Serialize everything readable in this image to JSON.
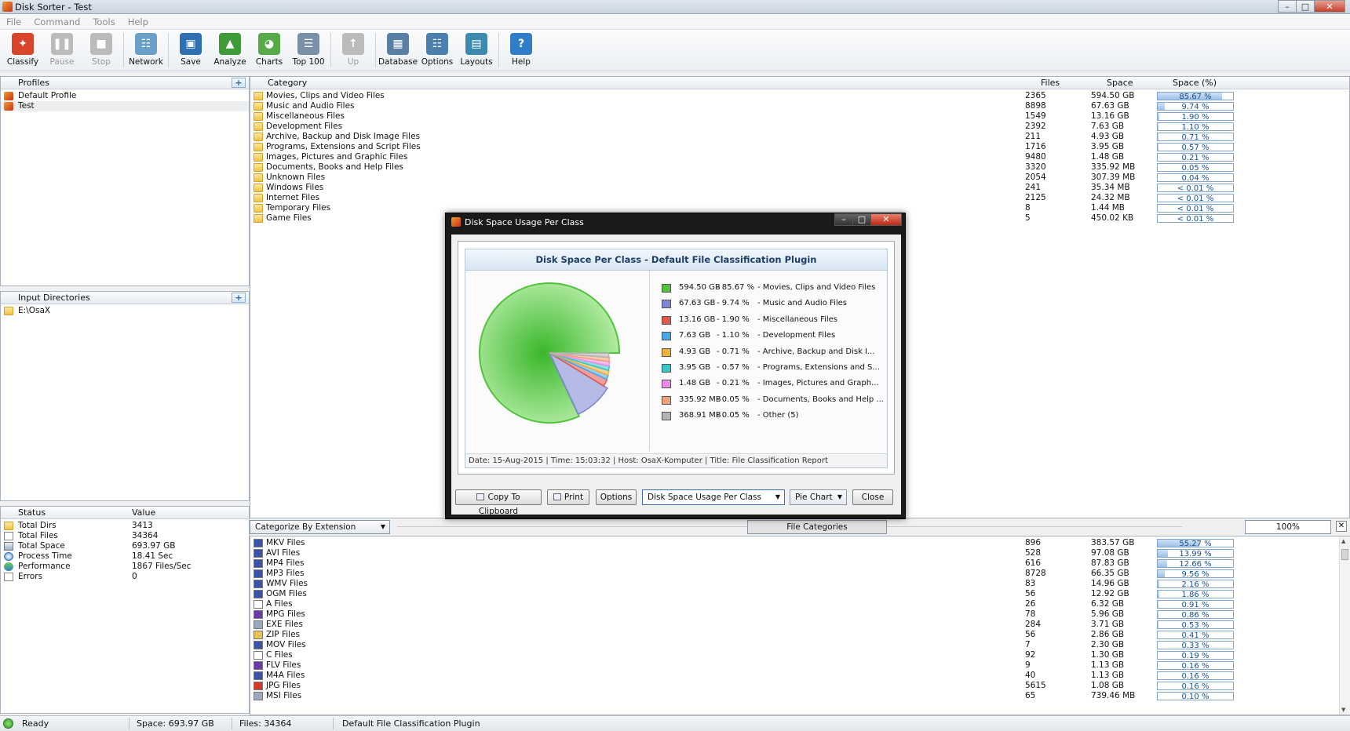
{
  "window": {
    "title": "Disk Sorter - Test",
    "min": "–",
    "max": "□",
    "close": "✕"
  },
  "menu": [
    "File",
    "Command",
    "Tools",
    "Help"
  ],
  "toolbar": [
    {
      "label": "Classify",
      "icon": "classify-icon",
      "color": "#d9452b",
      "glyph": "✦",
      "disabled": false
    },
    {
      "label": "Pause",
      "icon": "pause-icon",
      "color": "#999",
      "glyph": "❚❚",
      "disabled": true
    },
    {
      "label": "Stop",
      "icon": "stop-icon",
      "color": "#999",
      "glyph": "■",
      "disabled": true
    },
    {
      "sep": true
    },
    {
      "label": "Network",
      "icon": "network-icon",
      "color": "#6aa0c8",
      "glyph": "☷",
      "disabled": false
    },
    {
      "sep": true
    },
    {
      "label": "Save",
      "icon": "save-icon",
      "color": "#2f6fb3",
      "glyph": "▣",
      "disabled": false
    },
    {
      "label": "Analyze",
      "icon": "analyze-icon",
      "color": "#3f9a3a",
      "glyph": "▲",
      "disabled": false
    },
    {
      "label": "Charts",
      "icon": "charts-icon",
      "color": "#57a94a",
      "glyph": "◕",
      "disabled": false
    },
    {
      "label": "Top 100",
      "icon": "top100-icon",
      "color": "#7a8fa8",
      "glyph": "☰",
      "disabled": false
    },
    {
      "sep": true
    },
    {
      "label": "Up",
      "icon": "up-arrow-icon",
      "color": "#aaa",
      "glyph": "↑",
      "disabled": true
    },
    {
      "sep": true
    },
    {
      "label": "Database",
      "icon": "database-icon",
      "color": "#5a7fa6",
      "glyph": "▦",
      "disabled": false
    },
    {
      "label": "Options",
      "icon": "options-icon",
      "color": "#4a7fae",
      "glyph": "☷",
      "disabled": false
    },
    {
      "label": "Layouts",
      "icon": "layouts-icon",
      "color": "#3d8ab0",
      "glyph": "▤",
      "disabled": false
    },
    {
      "sep": true
    },
    {
      "label": "Help",
      "icon": "help-icon",
      "color": "#2f7ec7",
      "glyph": "?",
      "disabled": false
    }
  ],
  "profiles": {
    "header": "Profiles",
    "items": [
      {
        "label": "Default Profile",
        "selected": false
      },
      {
        "label": "Test",
        "selected": true
      }
    ]
  },
  "input_dirs": {
    "header": "Input Directories",
    "items": [
      "E:\\OsaX"
    ]
  },
  "status_panel": {
    "col1": "Status",
    "col2": "Value",
    "rows": [
      {
        "label": "Total Dirs",
        "value": "3413",
        "icon": "folder-icon"
      },
      {
        "label": "Total Files",
        "value": "34364",
        "icon": "file-icon"
      },
      {
        "label": "Total Space",
        "value": "693.97 GB",
        "icon": "disk-icon"
      },
      {
        "label": "Process Time",
        "value": "18.41 Sec",
        "icon": "clock-icon"
      },
      {
        "label": "Performance",
        "value": "1867 Files/Sec",
        "icon": "performance-icon"
      },
      {
        "label": "Errors",
        "value": "0",
        "icon": "errors-icon"
      }
    ]
  },
  "categories_table": {
    "headers": {
      "category": "Category",
      "files": "Files",
      "space": "Space",
      "pct": "Space (%)"
    },
    "rows": [
      {
        "name": "Movies, Clips and Video Files",
        "files": "2365",
        "space": "594.50 GB",
        "pct": "85.67 %",
        "fill": 0.8567
      },
      {
        "name": "Music and Audio Files",
        "files": "8898",
        "space": "67.63 GB",
        "pct": "9.74 %",
        "fill": 0.0974
      },
      {
        "name": "Miscellaneous Files",
        "files": "1549",
        "space": "13.16 GB",
        "pct": "1.90 %",
        "fill": 0.019
      },
      {
        "name": "Development Files",
        "files": "2392",
        "space": "7.63 GB",
        "pct": "1.10 %",
        "fill": 0.011
      },
      {
        "name": "Archive, Backup and Disk Image Files",
        "files": "211",
        "space": "4.93 GB",
        "pct": "0.71 %",
        "fill": 0.0071
      },
      {
        "name": "Programs, Extensions and Script Files",
        "files": "1716",
        "space": "3.95 GB",
        "pct": "0.57 %",
        "fill": 0.0057
      },
      {
        "name": "Images, Pictures and Graphic Files",
        "files": "9480",
        "space": "1.48 GB",
        "pct": "0.21 %",
        "fill": 0.0021
      },
      {
        "name": "Documents, Books and Help Files",
        "files": "3320",
        "space": "335.92 MB",
        "pct": "0.05 %",
        "fill": 0.0005
      },
      {
        "name": "Unknown Files",
        "files": "2054",
        "space": "307.39 MB",
        "pct": "0.04 %",
        "fill": 0.0004
      },
      {
        "name": "Windows Files",
        "files": "241",
        "space": "35.34 MB",
        "pct": "< 0.01 %",
        "fill": 0
      },
      {
        "name": "Internet Files",
        "files": "2125",
        "space": "24.32 MB",
        "pct": "< 0.01 %",
        "fill": 0
      },
      {
        "name": "Temporary Files",
        "files": "8",
        "space": "1.44 MB",
        "pct": "< 0.01 %",
        "fill": 0
      },
      {
        "name": "Game Files",
        "files": "5",
        "space": "450.02 KB",
        "pct": "< 0.01 %",
        "fill": 0
      }
    ]
  },
  "midbar": {
    "categorize": "Categorize By Extension",
    "tab": "File Categories",
    "zoom": "100%",
    "close": "✕"
  },
  "extensions_table": {
    "rows": [
      {
        "name": "MKV Files",
        "files": "896",
        "space": "383.57 GB",
        "pct": "55.27 %",
        "fill": 0.5527,
        "color": "#3a52a8"
      },
      {
        "name": "AVI Files",
        "files": "528",
        "space": "97.08 GB",
        "pct": "13.99 %",
        "fill": 0.1399,
        "color": "#3a52a8"
      },
      {
        "name": "MP4 Files",
        "files": "616",
        "space": "87.83 GB",
        "pct": "12.66 %",
        "fill": 0.1266,
        "color": "#3a52a8"
      },
      {
        "name": "MP3 Files",
        "files": "8728",
        "space": "66.35 GB",
        "pct": "9.56 %",
        "fill": 0.0956,
        "color": "#3a52a8"
      },
      {
        "name": "WMV Files",
        "files": "83",
        "space": "14.96 GB",
        "pct": "2.16 %",
        "fill": 0.0216,
        "color": "#3a52a8"
      },
      {
        "name": "OGM Files",
        "files": "56",
        "space": "12.92 GB",
        "pct": "1.86 %",
        "fill": 0.0186,
        "color": "#3a52a8"
      },
      {
        "name": "A Files",
        "files": "26",
        "space": "6.32 GB",
        "pct": "0.91 %",
        "fill": 0.0091,
        "color": "#ffffff"
      },
      {
        "name": "MPG Files",
        "files": "78",
        "space": "5.96 GB",
        "pct": "0.86 %",
        "fill": 0.0086,
        "color": "#6a3aa8"
      },
      {
        "name": "EXE Files",
        "files": "284",
        "space": "3.71 GB",
        "pct": "0.53 %",
        "fill": 0.0053,
        "color": "#9aa9bd"
      },
      {
        "name": "ZIP Files",
        "files": "56",
        "space": "2.86 GB",
        "pct": "0.41 %",
        "fill": 0.0041,
        "color": "#e7c451"
      },
      {
        "name": "MOV Files",
        "files": "7",
        "space": "2.30 GB",
        "pct": "0.33 %",
        "fill": 0.0033,
        "color": "#3a52a8"
      },
      {
        "name": "C Files",
        "files": "92",
        "space": "1.30 GB",
        "pct": "0.19 %",
        "fill": 0.0019,
        "color": "#ffffff"
      },
      {
        "name": "FLV Files",
        "files": "9",
        "space": "1.13 GB",
        "pct": "0.16 %",
        "fill": 0.0016,
        "color": "#6a3aa8"
      },
      {
        "name": "M4A Files",
        "files": "40",
        "space": "1.13 GB",
        "pct": "0.16 %",
        "fill": 0.0016,
        "color": "#3a52a8"
      },
      {
        "name": "JPG Files",
        "files": "5615",
        "space": "1.08 GB",
        "pct": "0.16 %",
        "fill": 0.0016,
        "color": "#d43a2a"
      },
      {
        "name": "MSI Files",
        "files": "65",
        "space": "739.46 MB",
        "pct": "0.10 %",
        "fill": 0.001,
        "color": "#9aa9bd"
      }
    ]
  },
  "statusbar": {
    "state": "Ready",
    "space": "Space: 693.97 GB",
    "files": "Files: 34364",
    "plugin": "Default File Classification Plugin"
  },
  "dialog": {
    "title": "Disk Space Usage Per Class",
    "footer": "Date: 15-Aug-2015 | Time: 15:03:32 | Host: OsaX-Komputer | Title: File Classification Report",
    "buttons": {
      "copy": "Copy To Clipboard",
      "print": "Print",
      "options": "Options",
      "close": "Close"
    },
    "report_select": "Disk Space Usage Per Class",
    "chart_type_select": "Pie Chart"
  },
  "chart_data": {
    "type": "pie",
    "title": "Disk Space Per Class - Default File Classification Plugin",
    "legend_placement": "right",
    "slices": [
      {
        "label": "Movies, Clips and Video Files",
        "size": "594.50 GB",
        "pct_label": "85.67 %",
        "value": 85.67,
        "color": "#4fc43a"
      },
      {
        "label": "Music and Audio Files",
        "size": "67.63 GB",
        "pct_label": "9.74 %",
        "value": 9.74,
        "color": "#7b86d6"
      },
      {
        "label": "Miscellaneous Files",
        "size": "13.16 GB",
        "pct_label": "1.90 %",
        "value": 1.9,
        "color": "#e2574a"
      },
      {
        "label": "Development Files",
        "size": "7.63 GB",
        "pct_label": "1.10 %",
        "value": 1.1,
        "color": "#49a9e8"
      },
      {
        "label": "Archive, Backup and Disk I...",
        "size": "4.93 GB",
        "pct_label": "0.71 %",
        "value": 0.71,
        "color": "#f2b13c"
      },
      {
        "label": "Programs, Extensions and S...",
        "size": "3.95 GB",
        "pct_label": "0.57 %",
        "value": 0.57,
        "color": "#35c8c8"
      },
      {
        "label": "Images, Pictures and Graph...",
        "size": "1.48 GB",
        "pct_label": "0.21 %",
        "value": 0.21,
        "color": "#f08ae8"
      },
      {
        "label": "Documents, Books and Help ...",
        "size": "335.92 MB",
        "pct_label": "0.05 %",
        "value": 0.05,
        "color": "#f4a07a"
      },
      {
        "label": "Other (5)",
        "size": "368.91 MB",
        "pct_label": "0.05 %",
        "value": 0.05,
        "color": "#b4b4b4"
      }
    ]
  }
}
